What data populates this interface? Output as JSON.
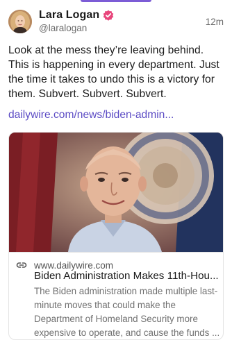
{
  "author": {
    "display_name": "Lara Logan",
    "handle": "@laralogan",
    "verified_icon": "verified-badge-icon",
    "timestamp": "12m"
  },
  "post": {
    "text": "Look at the mess they’re leaving behind. This is happening in every department. Just the time it takes to undo this is a victory for them. Subvert. Subvert. Subvert.",
    "link": "dailywire.com/news/biden-admin..."
  },
  "link_card": {
    "domain_icon": "link-icon",
    "domain": "www.dailywire.com",
    "title": "Biden Administration Makes 11th-Hou...",
    "description": "The Biden administration made multiple last-minute moves that could make the Department of Homeland Security more expensive to operate, and cause the funds ..."
  },
  "colors": {
    "accent": "#7c5cd6",
    "link": "#5b4bc4",
    "verified_badge": "#e8467c"
  }
}
